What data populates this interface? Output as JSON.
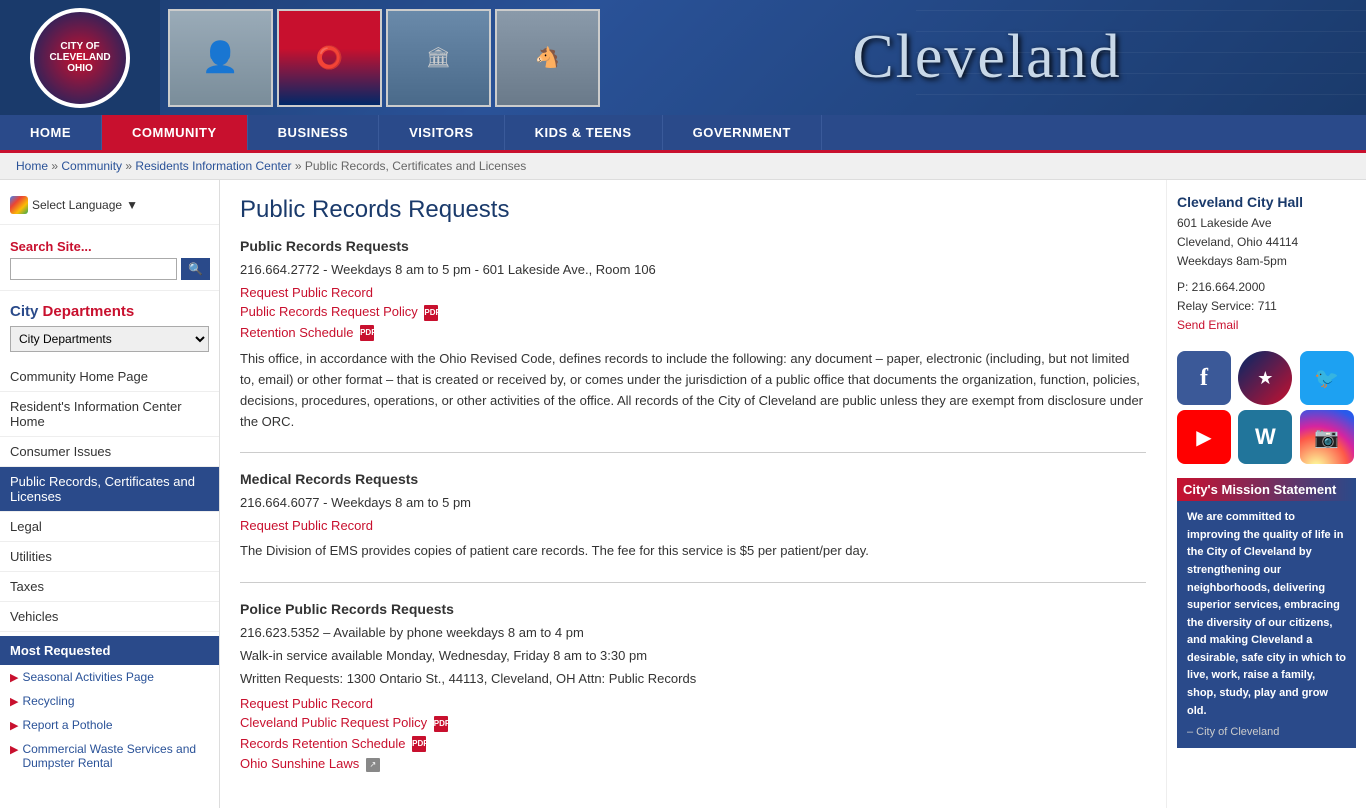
{
  "header": {
    "city_name": "Cleveland",
    "logo_text": "CITY OF CLEVELAND OHIO"
  },
  "nav": {
    "items": [
      {
        "label": "HOME",
        "href": "#",
        "active": false
      },
      {
        "label": "COMMUNITY",
        "href": "#",
        "active": true
      },
      {
        "label": "BUSINESS",
        "href": "#",
        "active": false
      },
      {
        "label": "VISITORS",
        "href": "#",
        "active": false
      },
      {
        "label": "KIDS & TEENS",
        "href": "#",
        "active": false
      },
      {
        "label": "GOVERNMENT",
        "href": "#",
        "active": false
      }
    ]
  },
  "breadcrumb": {
    "items": [
      "Home",
      "Community",
      "Residents Information Center",
      "Public Records, Certificates and Licenses"
    ]
  },
  "sidebar": {
    "translate_label": "Select Language",
    "search_label": "Search Site...",
    "search_placeholder": "",
    "departments_label": "City Departments",
    "departments_options": [
      "City Departments"
    ],
    "nav_items": [
      {
        "label": "Community Home Page",
        "active": false
      },
      {
        "label": "Resident's Information Center Home",
        "active": false
      },
      {
        "label": "Consumer Issues",
        "active": false
      },
      {
        "label": "Public Records, Certificates and Licenses",
        "active": true
      },
      {
        "label": "Legal",
        "active": false
      },
      {
        "label": "Utilities",
        "active": false
      },
      {
        "label": "Taxes",
        "active": false
      },
      {
        "label": "Vehicles",
        "active": false
      }
    ],
    "most_requested_label": "Most Requested",
    "most_requested_links": [
      {
        "label": "Seasonal Activities Page"
      },
      {
        "label": "Recycling"
      },
      {
        "label": "Report a Pothole"
      },
      {
        "label": "Commercial Waste Services and Dumpster Rental"
      }
    ]
  },
  "content": {
    "page_title": "Public Records Requests",
    "sections": [
      {
        "heading": "Public Records Requests",
        "phone_info": "216.664.2772 - Weekdays 8 am to 5 pm - 601 Lakeside Ave., Room 106",
        "links": [
          {
            "label": "Request Public Record",
            "has_pdf": false
          },
          {
            "label": "Public Records Request Policy",
            "has_pdf": true
          },
          {
            "label": "Retention Schedule",
            "has_pdf": true
          }
        ],
        "description": "This office, in accordance with the Ohio Revised Code, defines records to include the following: any document – paper, electronic (including, but not limited to, email) or other format – that is created or received by, or comes under the jurisdiction of a public office that documents the organization, function, policies, decisions, procedures, operations, or other activities of the office. All records of the City of Cleveland are public unless they are exempt from disclosure under the ORC."
      },
      {
        "heading": "Medical Records Requests",
        "phone_info": "216.664.6077 - Weekdays 8 am to 5 pm",
        "links": [
          {
            "label": "Request Public Record",
            "has_pdf": false
          }
        ],
        "description": "The Division of EMS provides copies of patient care records. The fee for this service is $5 per patient/per day."
      },
      {
        "heading": "Police Public Records Requests",
        "phone_info": "216.623.5352 – Available by phone weekdays 8 am to 4 pm",
        "phone_info2": "Walk-in service available Monday, Wednesday, Friday 8 am to 3:30 pm",
        "phone_info3": "Written Requests: 1300 Ontario St., 44113, Cleveland, OH Attn: Public Records",
        "links": [
          {
            "label": "Request Public Record",
            "has_pdf": false
          },
          {
            "label": "Cleveland Public Request Policy",
            "has_pdf": true
          },
          {
            "label": "Records Retention Schedule",
            "has_pdf": true
          },
          {
            "label": "Ohio Sunshine Laws",
            "has_ext": true
          }
        ]
      }
    ]
  },
  "right_sidebar": {
    "city_hall_name": "Cleveland City Hall",
    "city_hall_address": "601 Lakeside Ave\nCleveland, Ohio 44114\nWeekdays 8am-5pm",
    "city_hall_phone": "P: 216.664.2000",
    "city_hall_relay": "Relay Service: 711",
    "city_hall_email_label": "Send Email",
    "social": [
      {
        "name": "facebook",
        "icon": "f"
      },
      {
        "name": "seal",
        "icon": "★"
      },
      {
        "name": "twitter",
        "icon": "🐦"
      },
      {
        "name": "youtube",
        "icon": "▶"
      },
      {
        "name": "wordpress",
        "icon": "W"
      },
      {
        "name": "instagram",
        "icon": "📷"
      }
    ],
    "mission_title": "City's Mission Statement",
    "mission_text": "We are committed to improving the quality of life in the City of Cleveland by strengthening our neighborhoods, delivering superior services, embracing the diversity of our citizens, and making Cleveland a desirable, safe city in which to live, work, raise a family, shop, study, play and grow old.",
    "mission_credit": "– City of Cleveland"
  }
}
